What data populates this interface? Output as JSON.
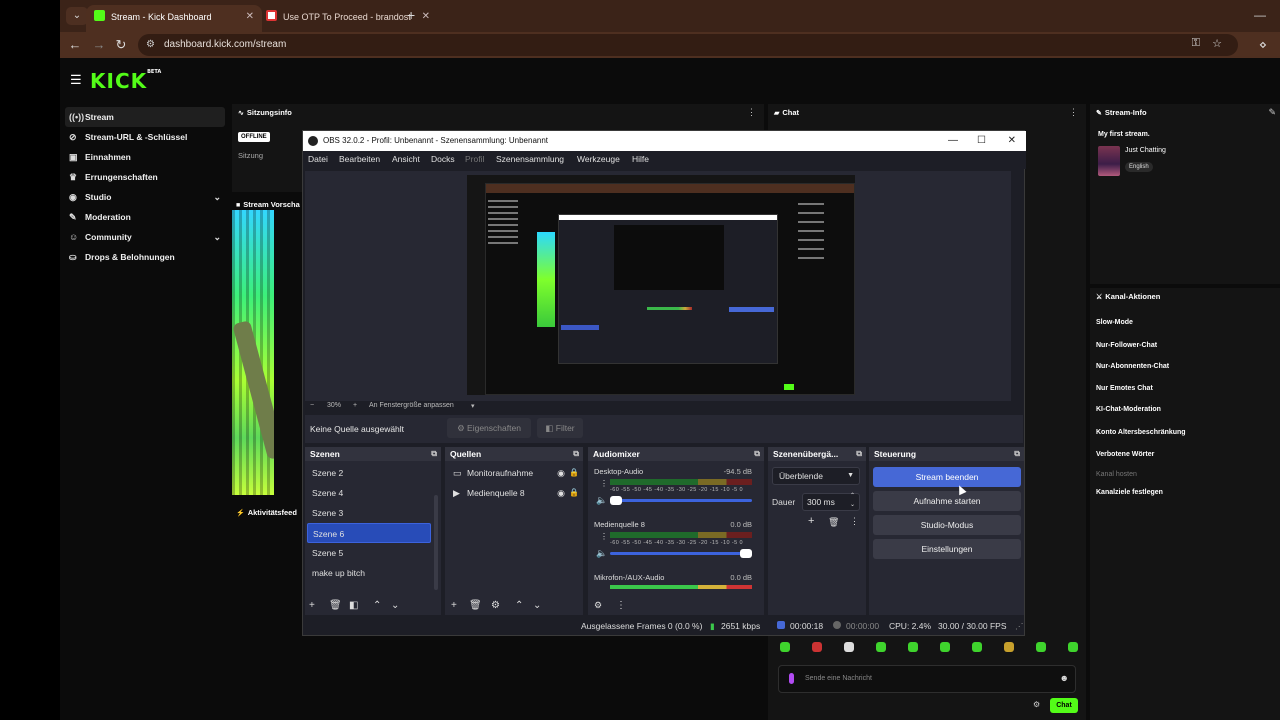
{
  "browser": {
    "tabs": [
      {
        "title": "Stream - Kick Dashboard",
        "active": true
      },
      {
        "title": "Use OTP To Proceed - brandost",
        "active": false
      }
    ],
    "url": "dashboard.kick.com/stream"
  },
  "kick": {
    "logo": "KICK",
    "logo_badge": "BETA",
    "sidebar": [
      {
        "label": "Stream",
        "icon": "broadcast-icon",
        "active": true
      },
      {
        "label": "Stream-URL & -Schlüssel",
        "icon": "link-icon"
      },
      {
        "label": "Einnahmen",
        "icon": "wallet-icon"
      },
      {
        "label": "Errungenschaften",
        "icon": "trophy-icon"
      },
      {
        "label": "Studio",
        "icon": "studio-icon",
        "expand": true
      },
      {
        "label": "Moderation",
        "icon": "wrench-icon"
      },
      {
        "label": "Community",
        "icon": "community-icon",
        "expand": true
      },
      {
        "label": "Drops & Belohnungen",
        "icon": "drops-icon"
      }
    ],
    "session": {
      "title": "Sitzungsinfo",
      "status": "OFFLINE",
      "label": "Sitzung"
    },
    "preview_title": "Stream Vorscha",
    "activity_title": "Aktivitätsfeed",
    "chat": {
      "title": "Chat",
      "placeholder": "Sende eine Nachricht",
      "send_label": "Chat"
    },
    "stream_info": {
      "title": "Stream-Info",
      "stream_title": "My first stream.",
      "category": "Just Chatting",
      "language": "English"
    },
    "channel_actions": {
      "title": "Kanal-Aktionen",
      "items": [
        {
          "label": "Slow-Mode"
        },
        {
          "label": "Nur-Follower-Chat"
        },
        {
          "label": "Nur-Abonnenten-Chat"
        },
        {
          "label": "Nur Emotes Chat"
        },
        {
          "label": "KI-Chat-Moderation"
        },
        {
          "label": "Konto Altersbeschränkung"
        },
        {
          "label": "Verbotene Wörter"
        },
        {
          "label": "Kanal hosten",
          "disabled": true
        },
        {
          "label": "Kanalziele festlegen"
        }
      ]
    }
  },
  "obs": {
    "title": "OBS 32.0.2 - Profil: Unbenannt - Szenensammlung: Unbenannt",
    "menu": [
      "Datei",
      "Bearbeiten",
      "Ansicht",
      "Docks",
      "Profil",
      "Szenensammlung",
      "Werkzeuge",
      "Hilfe"
    ],
    "zoom": {
      "minus": "−",
      "level": "30%",
      "plus": "+",
      "fit": "An Fenstergröße anpassen"
    },
    "no_source": "Keine Quelle ausgewählt",
    "properties_label": "Eigenschaften",
    "filter_label": "Filter",
    "scenes": {
      "title": "Szenen",
      "items": [
        "Szene 2",
        "Szene 4",
        "Szene 3",
        "Szene 6",
        "Szene 5",
        "make up bitch"
      ],
      "selected": "Szene 6"
    },
    "sources": {
      "title": "Quellen",
      "items": [
        {
          "label": "Monitoraufnahme",
          "icon": "monitor-icon"
        },
        {
          "label": "Medienquelle 8",
          "icon": "play-icon"
        }
      ]
    },
    "mixer": {
      "title": "Audiomixer",
      "ticks": "-60 -55 -50 -45 -40 -35 -30 -25 -20 -15 -10 -5 0",
      "channels": [
        {
          "name": "Desktop-Audio",
          "db": "-94.5 dB",
          "volume": 0.0
        },
        {
          "name": "Medienquelle 8",
          "db": "0.0 dB",
          "volume": 1.0
        },
        {
          "name": "Mikrofon-/AUX-Audio",
          "db": "0.0 dB"
        }
      ]
    },
    "transitions": {
      "title": "Szenenübergä...",
      "selected": "Überblende",
      "duration_label": "Dauer",
      "duration_value": "300 ms"
    },
    "controls": {
      "title": "Steuerung",
      "buttons": [
        {
          "label": "Stream beenden",
          "primary": true
        },
        {
          "label": "Aufnahme starten"
        },
        {
          "label": "Studio-Modus"
        },
        {
          "label": "Einstellungen"
        }
      ]
    },
    "status": {
      "dropped": "Ausgelassene Frames 0 (0.0 %)",
      "bitrate": "2651 kbps",
      "stream_time": "00:00:18",
      "rec_time": "00:00:00",
      "cpu": "CPU: 2.4%",
      "fps": "30.00 / 30.00 FPS"
    }
  },
  "colors": {
    "kick_green": "#53fc18",
    "obs_accent": "#4668d6",
    "browser_frame": "#4e2f20"
  }
}
